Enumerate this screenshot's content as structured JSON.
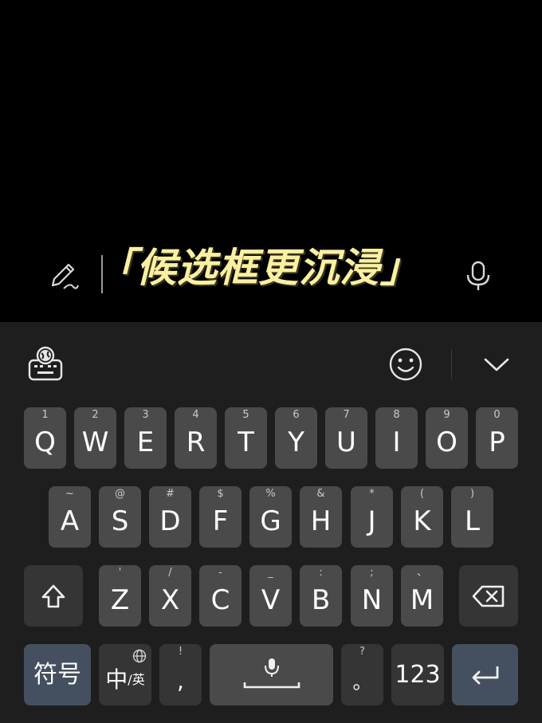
{
  "caption": {
    "text": "「候选框更沉浸」"
  },
  "row1": [
    {
      "hint": "1",
      "label": "Q"
    },
    {
      "hint": "2",
      "label": "W"
    },
    {
      "hint": "3",
      "label": "E"
    },
    {
      "hint": "4",
      "label": "R"
    },
    {
      "hint": "5",
      "label": "T"
    },
    {
      "hint": "6",
      "label": "Y"
    },
    {
      "hint": "7",
      "label": "U"
    },
    {
      "hint": "8",
      "label": "I"
    },
    {
      "hint": "9",
      "label": "O"
    },
    {
      "hint": "0",
      "label": "P"
    }
  ],
  "row2": [
    {
      "hint": "~",
      "label": "A"
    },
    {
      "hint": "@",
      "label": "S"
    },
    {
      "hint": "#",
      "label": "D"
    },
    {
      "hint": "$",
      "label": "F"
    },
    {
      "hint": "%",
      "label": "G"
    },
    {
      "hint": "&",
      "label": "H"
    },
    {
      "hint": "*",
      "label": "J"
    },
    {
      "hint": "(",
      "label": "K"
    },
    {
      "hint": ")",
      "label": "L"
    }
  ],
  "row3": [
    {
      "hint": "'",
      "label": "Z"
    },
    {
      "hint": "/",
      "label": "X"
    },
    {
      "hint": "-",
      "label": "C"
    },
    {
      "hint": "_",
      "label": "V"
    },
    {
      "hint": ":",
      "label": "B"
    },
    {
      "hint": ";",
      "label": "N"
    },
    {
      "hint": "、",
      "label": "M"
    }
  ],
  "bottom": {
    "symbols_label": "符号",
    "lang_zh": "中",
    "lang_en": "/英",
    "comma_hint": "!",
    "comma_label": ",",
    "period_hint": "?",
    "period_label": "。",
    "numbers_label": "123"
  },
  "icons": {
    "pen": "handwriting-pen-icon",
    "mic": "microphone-icon",
    "keyboard_settings": "keyboard-globe-icon",
    "emoji": "smiley-icon",
    "collapse": "chevron-down-icon",
    "shift": "shift-arrow-icon",
    "backspace": "backspace-icon",
    "globe": "globe-icon",
    "space_mic": "space-mic-icon",
    "enter": "enter-return-icon"
  },
  "colors": {
    "background": "#000000",
    "keyboard_bg": "#1e1e1e",
    "key": "#4a4a4a",
    "func_key": "#353535",
    "accent_key": "#44505f",
    "caption": "#fbf0a0"
  }
}
